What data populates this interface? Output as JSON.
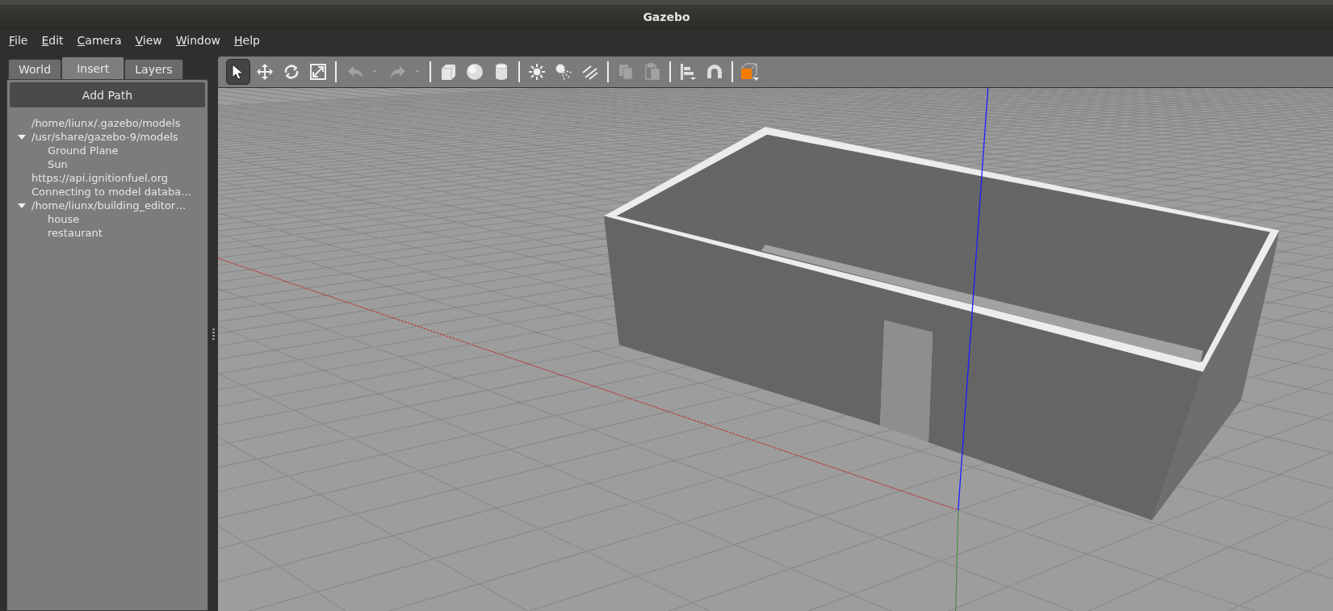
{
  "window": {
    "title": "Gazebo"
  },
  "menu": [
    "File",
    "Edit",
    "Camera",
    "View",
    "Window",
    "Help"
  ],
  "tabs": [
    {
      "label": "World",
      "selected": false
    },
    {
      "label": "Insert",
      "selected": true
    },
    {
      "label": "Layers",
      "selected": false
    }
  ],
  "add_path_button": "Add Path",
  "tree": [
    {
      "label": "/home/liunx/.gazebo/models"
    },
    {
      "label": "/usr/share/gazebo-9/models",
      "expanded": true,
      "children": [
        {
          "label": "Ground Plane"
        },
        {
          "label": "Sun"
        }
      ]
    },
    {
      "label": "https://api.ignitionfuel.org"
    },
    {
      "label": "Connecting to model databa…"
    },
    {
      "label": "/home/liunx/building_editor…",
      "expanded": true,
      "children": [
        {
          "label": "house"
        },
        {
          "label": "restaurant"
        }
      ]
    }
  ],
  "toolbar": [
    {
      "kind": "select",
      "selected": true,
      "disabled": false
    },
    {
      "kind": "translate",
      "selected": false,
      "disabled": false
    },
    {
      "kind": "rotate",
      "selected": false,
      "disabled": false
    },
    {
      "kind": "scale",
      "selected": false,
      "disabled": false
    },
    {
      "kind": "separator"
    },
    {
      "kind": "undo",
      "selected": false,
      "disabled": true
    },
    {
      "kind": "redo",
      "selected": false,
      "disabled": true
    },
    {
      "kind": "separator"
    },
    {
      "kind": "box",
      "selected": false,
      "disabled": false
    },
    {
      "kind": "sphere",
      "selected": false,
      "disabled": false
    },
    {
      "kind": "cylinder",
      "selected": false,
      "disabled": false
    },
    {
      "kind": "separator"
    },
    {
      "kind": "point_light",
      "selected": false,
      "disabled": false
    },
    {
      "kind": "spot_light",
      "selected": false,
      "disabled": false
    },
    {
      "kind": "directional_light",
      "selected": false,
      "disabled": false
    },
    {
      "kind": "separator"
    },
    {
      "kind": "copy",
      "selected": false,
      "disabled": true
    },
    {
      "kind": "paste",
      "selected": false,
      "disabled": true
    },
    {
      "kind": "separator"
    },
    {
      "kind": "align",
      "selected": false,
      "disabled": false
    },
    {
      "kind": "snap",
      "selected": false,
      "disabled": false
    },
    {
      "kind": "separator"
    },
    {
      "kind": "view_angle",
      "selected": false,
      "disabled": false
    }
  ]
}
